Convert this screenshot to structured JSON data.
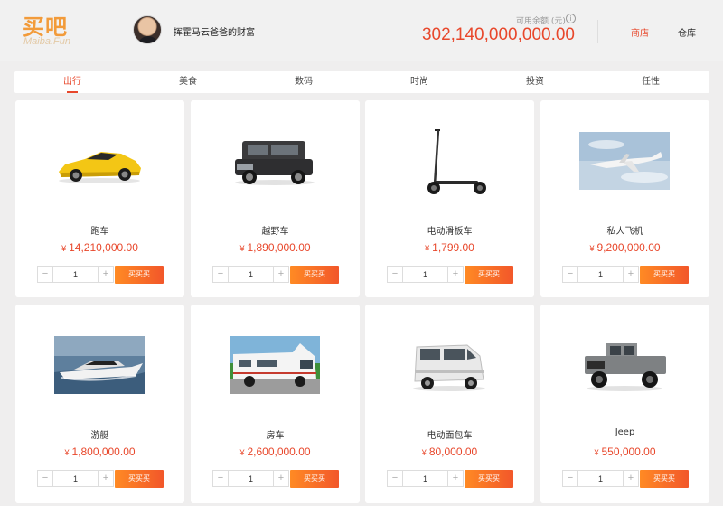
{
  "header": {
    "logo_cn": "买吧",
    "logo_en": "Maiba.Fun",
    "user_caption": "挥霍马云爸爸的财富",
    "balance_label": "可用余额 (元)",
    "balance_value": "302,140,000,000.00",
    "nav_shop": "商店",
    "nav_store": "仓库"
  },
  "tabs": [
    "出行",
    "美食",
    "数码",
    "时尚",
    "投资",
    "任性"
  ],
  "active_tab": 0,
  "currency_symbol": "¥",
  "buy_label": "买买买",
  "products": [
    {
      "name": "跑车",
      "price": "14,210,000.00",
      "qty": "1",
      "icon": "sports-car-image"
    },
    {
      "name": "越野车",
      "price": "1,890,000.00",
      "qty": "1",
      "icon": "suv-image"
    },
    {
      "name": "电动滑板车",
      "price": "1,799.00",
      "qty": "1",
      "icon": "scooter-image"
    },
    {
      "name": "私人飞机",
      "price": "9,200,000.00",
      "qty": "1",
      "icon": "private-jet-image"
    },
    {
      "name": "游艇",
      "price": "1,800,000.00",
      "qty": "1",
      "icon": "yacht-image"
    },
    {
      "name": "房车",
      "price": "2,600,000.00",
      "qty": "1",
      "icon": "rv-image"
    },
    {
      "name": "电动面包车",
      "price": "80,000.00",
      "qty": "1",
      "icon": "van-image"
    },
    {
      "name": "Jeep",
      "price": "550,000.00",
      "qty": "1",
      "icon": "jeep-image"
    }
  ],
  "colors": {
    "accent": "#e8472b",
    "button_start": "#ff8a24",
    "button_end": "#f2572a",
    "logo": "#f29b3a"
  }
}
